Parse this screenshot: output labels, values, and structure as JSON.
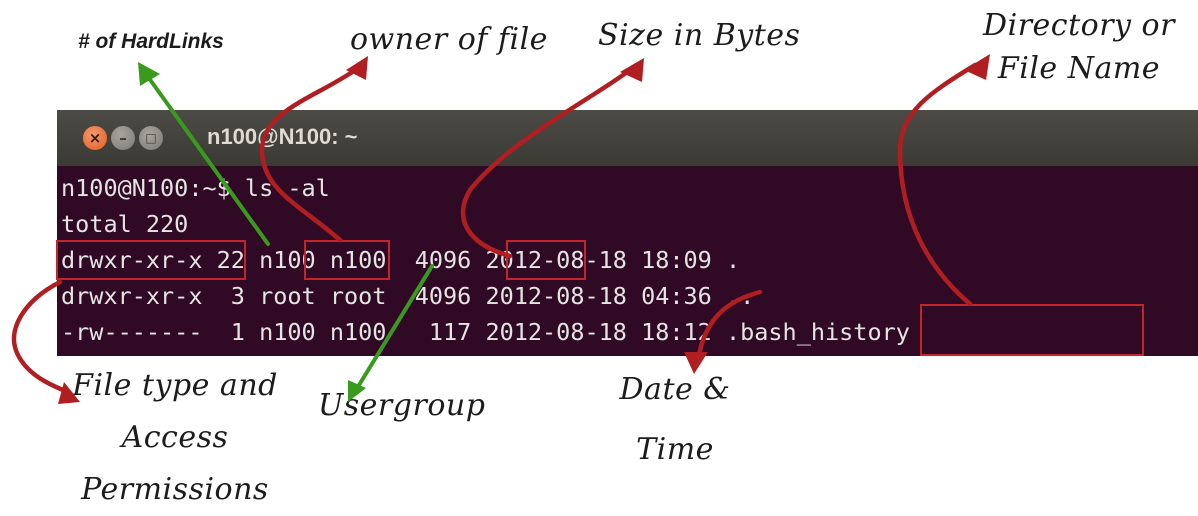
{
  "labels": {
    "hardlinks": "# of HardLinks",
    "owner": "owner of file",
    "size": "Size in Bytes",
    "name_line1": "Directory or",
    "name_line2": "File Name",
    "perms_line1": "File type and",
    "perms_line2": "Access",
    "perms_line3": "Permissions",
    "usergroup": "Usergroup",
    "date_line1": "Date &",
    "date_line2": "Time"
  },
  "terminal": {
    "window_title": "n100@N100: ~",
    "buttons": {
      "close": "×",
      "minimize": "–",
      "maximize": "□"
    },
    "lines": [
      "n100@N100:~$ ls -al",
      "total 220",
      "drwxr-xr-x 22 n100 n100  4096 2012-08-18 18:09 .",
      "drwxr-xr-x  3 root root  4096 2012-08-18 04:36 ..",
      "-rw-------  1 n100 n100   117 2012-08-18 18:12 .bash_history"
    ]
  },
  "colors": {
    "terminal_bg": "#300a24",
    "red_arrow": "#b01e22",
    "green_arrow": "#3a9a1e",
    "highlight_box": "#c0262c"
  }
}
